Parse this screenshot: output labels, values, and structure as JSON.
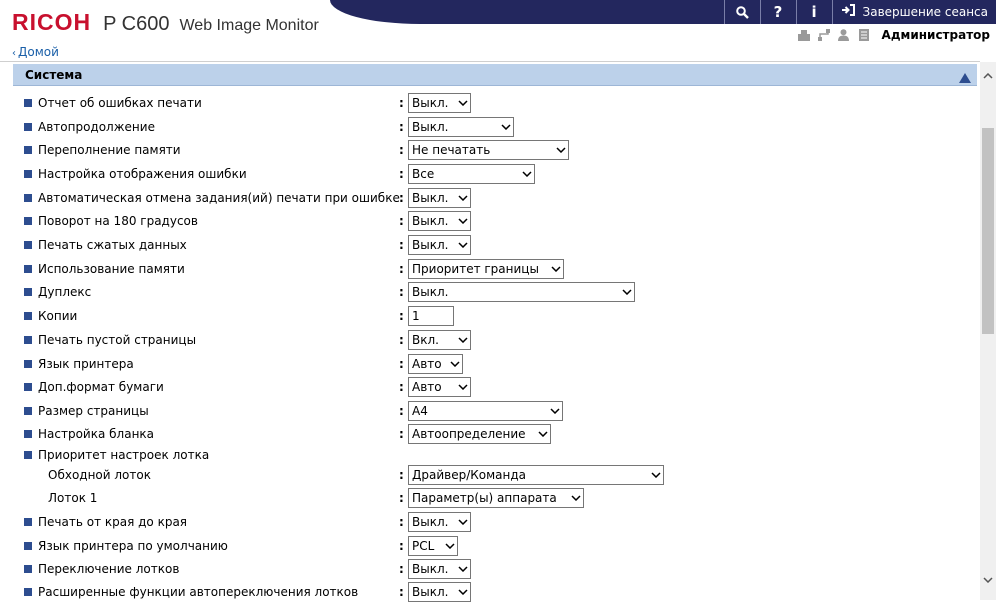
{
  "header": {
    "logo": "RICOH",
    "model": "P C600",
    "app_name": "Web Image Monitor",
    "tools": {
      "search_icon": "search-icon",
      "help_label": "?",
      "info_label": "i",
      "logout_label": "Завершение сеанса"
    },
    "user": "Администратор"
  },
  "breadcrumb": {
    "home": "Домой"
  },
  "section": {
    "title": "Система"
  },
  "settings": [
    {
      "label": "Отчет об ошибках печати",
      "value": "Выкл."
    },
    {
      "label": "Автопродолжение",
      "value": "Выкл."
    },
    {
      "label": "Переполнение памяти",
      "value": "Не печатать"
    },
    {
      "label": "Настройка отображения ошибки",
      "value": "Все"
    },
    {
      "label": "Автоматическая отмена задания(ий) печати при ошибке",
      "value": "Выкл."
    },
    {
      "label": "Поворот на 180 градусов",
      "value": "Выкл."
    },
    {
      "label": "Печать сжатых данных",
      "value": "Выкл."
    },
    {
      "label": "Использование памяти",
      "value": "Приоритет границы"
    },
    {
      "label": "Дуплекс",
      "value": "Выкл."
    },
    {
      "label": "Копии",
      "value": "1"
    },
    {
      "label": "Печать пустой страницы",
      "value": "Вкл."
    },
    {
      "label": "Язык принтера",
      "value": "Авто"
    },
    {
      "label": "Доп.формат бумаги",
      "value": "Авто"
    },
    {
      "label": "Размер страницы",
      "value": "A4"
    },
    {
      "label": "Настройка бланка",
      "value": "Автоопределение"
    },
    {
      "label": "Приоритет настроек лотка",
      "value": ""
    },
    {
      "label": "Обходной лоток",
      "value": "Драйвер/Команда"
    },
    {
      "label": "Лоток 1",
      "value": "Параметр(ы) аппарата"
    },
    {
      "label": "Печать от края до края",
      "value": "Выкл."
    },
    {
      "label": "Язык принтера по умолчанию",
      "value": "PCL"
    },
    {
      "label": "Переключение лотков",
      "value": "Выкл."
    },
    {
      "label": "Расширенные функции автопереключения лотков",
      "value": "Выкл."
    }
  ],
  "colors": {
    "header_band": "#23275e",
    "logo_red": "#c8102e",
    "section_bar": "#bcd1ea",
    "bullet": "#2d4d8f",
    "link": "#1a5fa8"
  }
}
